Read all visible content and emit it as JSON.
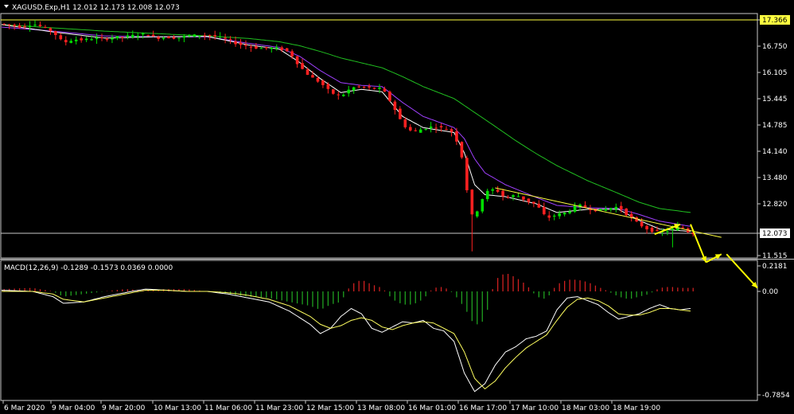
{
  "window": {
    "symbol_line": "XAGUSD.Exp,H1  12.012 12.173 12.008 12.073",
    "macd_line": "MACD(12,26,9) -0.1289 -0.1573 0.0369 0.0000"
  },
  "colors": {
    "background": "#000000",
    "bull_candle": "#00e000",
    "bear_candle": "#ff2020",
    "ema_fast": "#ffffff",
    "ema_mid": "#a040ff",
    "ema_slow": "#20c020",
    "trendline": "#ffff40",
    "arrows": "#ffff00",
    "macd_hist_pos": "#d02020",
    "macd_hist_neg": "#20a020",
    "macd_main": "#ffffff",
    "macd_signal": "#ffff60",
    "grid_lines": "#c8c8c8"
  },
  "chart_data": [
    {
      "type": "candlestick",
      "symbol": "XAGUSD.Exp",
      "timeframe": "H1",
      "ohlc_last": {
        "open": 12.012,
        "high": 12.173,
        "low": 12.008,
        "close": 12.073
      },
      "y_ticks": [
        "17.366",
        "16.750",
        "16.105",
        "15.445",
        "14.785",
        "14.140",
        "13.480",
        "12.820",
        "12.073",
        "11.515"
      ],
      "ylim": [
        11.42,
        17.54
      ],
      "horizontal_levels": [
        17.366,
        12.073
      ],
      "x_ticks": [
        "6 Mar 2020",
        "9 Mar 04:00",
        "9 Mar 20:00",
        "10 Mar 13:00",
        "11 Mar 06:00",
        "11 Mar 23:00",
        "12 Mar 15:00",
        "13 Mar 08:00",
        "16 Mar 01:00",
        "16 Mar 17:00",
        "17 Mar 10:00",
        "18 Mar 03:00",
        "18 Mar 19:00"
      ],
      "price_path": [
        [
          0,
          17.3
        ],
        [
          4,
          17.22
        ],
        [
          6,
          17.3
        ],
        [
          8,
          17.22
        ],
        [
          10,
          17.1
        ],
        [
          12,
          16.83
        ],
        [
          14,
          16.92
        ],
        [
          16,
          16.9
        ],
        [
          18,
          16.95
        ],
        [
          20,
          16.92
        ],
        [
          22,
          16.97
        ],
        [
          24,
          16.98
        ],
        [
          26,
          17.02
        ],
        [
          28,
          17.05
        ],
        [
          30,
          16.95
        ],
        [
          32,
          16.97
        ],
        [
          34,
          16.95
        ],
        [
          36,
          17.0
        ],
        [
          38,
          17.02
        ],
        [
          40,
          17.02
        ],
        [
          42,
          16.98
        ],
        [
          44,
          16.9
        ],
        [
          46,
          16.8
        ],
        [
          48,
          16.75
        ],
        [
          50,
          16.7
        ],
        [
          52,
          16.7
        ],
        [
          54,
          16.7
        ],
        [
          56,
          16.6
        ],
        [
          58,
          16.25
        ],
        [
          60,
          16.0
        ],
        [
          62,
          15.85
        ],
        [
          64,
          15.6
        ],
        [
          66,
          15.5
        ],
        [
          68,
          15.72
        ],
        [
          70,
          15.75
        ],
        [
          72,
          15.7
        ],
        [
          74,
          15.7
        ],
        [
          76,
          15.3
        ],
        [
          78,
          14.8
        ],
        [
          80,
          14.6
        ],
        [
          82,
          14.7
        ],
        [
          84,
          14.75
        ],
        [
          86,
          14.7
        ],
        [
          88,
          14.6
        ],
        [
          90,
          13.8
        ],
        [
          91,
          12.55
        ],
        [
          92,
          12.5
        ],
        [
          94,
          13.1
        ],
        [
          96,
          13.2
        ],
        [
          98,
          12.95
        ],
        [
          100,
          13.05
        ],
        [
          102,
          12.9
        ],
        [
          104,
          12.8
        ],
        [
          106,
          12.45
        ],
        [
          108,
          12.55
        ],
        [
          110,
          12.6
        ],
        [
          112,
          12.8
        ],
        [
          114,
          12.7
        ],
        [
          116,
          12.65
        ],
        [
          118,
          12.7
        ],
        [
          120,
          12.75
        ],
        [
          122,
          12.5
        ],
        [
          124,
          12.3
        ],
        [
          126,
          12.15
        ],
        [
          128,
          12.1
        ],
        [
          130,
          12.15
        ],
        [
          132,
          12.25
        ],
        [
          134,
          12.07
        ]
      ],
      "ema_fast_path": [
        [
          0,
          17.28
        ],
        [
          10,
          17.1
        ],
        [
          20,
          16.95
        ],
        [
          30,
          16.98
        ],
        [
          40,
          16.99
        ],
        [
          48,
          16.78
        ],
        [
          54,
          16.68
        ],
        [
          58,
          16.35
        ],
        [
          62,
          15.95
        ],
        [
          66,
          15.6
        ],
        [
          70,
          15.68
        ],
        [
          74,
          15.62
        ],
        [
          78,
          15.0
        ],
        [
          82,
          14.72
        ],
        [
          88,
          14.6
        ],
        [
          90,
          14.1
        ],
        [
          92,
          13.3
        ],
        [
          94,
          13.05
        ],
        [
          98,
          13.0
        ],
        [
          104,
          12.82
        ],
        [
          108,
          12.6
        ],
        [
          114,
          12.68
        ],
        [
          120,
          12.68
        ],
        [
          124,
          12.4
        ],
        [
          128,
          12.18
        ],
        [
          134,
          12.12
        ]
      ],
      "ema_mid_path": [
        [
          0,
          17.22
        ],
        [
          10,
          17.12
        ],
        [
          20,
          17.0
        ],
        [
          30,
          16.98
        ],
        [
          40,
          16.98
        ],
        [
          48,
          16.82
        ],
        [
          54,
          16.72
        ],
        [
          58,
          16.5
        ],
        [
          62,
          16.15
        ],
        [
          66,
          15.85
        ],
        [
          70,
          15.78
        ],
        [
          74,
          15.75
        ],
        [
          78,
          15.35
        ],
        [
          82,
          15.0
        ],
        [
          88,
          14.72
        ],
        [
          90,
          14.45
        ],
        [
          92,
          13.95
        ],
        [
          94,
          13.6
        ],
        [
          98,
          13.3
        ],
        [
          104,
          12.98
        ],
        [
          108,
          12.78
        ],
        [
          114,
          12.72
        ],
        [
          120,
          12.7
        ],
        [
          124,
          12.55
        ],
        [
          128,
          12.38
        ],
        [
          134,
          12.25
        ]
      ],
      "ema_slow_path": [
        [
          0,
          17.28
        ],
        [
          10,
          17.2
        ],
        [
          20,
          17.12
        ],
        [
          30,
          17.06
        ],
        [
          40,
          17.0
        ],
        [
          48,
          16.94
        ],
        [
          54,
          16.86
        ],
        [
          58,
          16.76
        ],
        [
          62,
          16.62
        ],
        [
          66,
          16.46
        ],
        [
          70,
          16.34
        ],
        [
          74,
          16.22
        ],
        [
          78,
          16.0
        ],
        [
          82,
          15.75
        ],
        [
          88,
          15.45
        ],
        [
          92,
          15.1
        ],
        [
          96,
          14.75
        ],
        [
          100,
          14.4
        ],
        [
          104,
          14.08
        ],
        [
          108,
          13.78
        ],
        [
          114,
          13.4
        ],
        [
          120,
          13.08
        ],
        [
          124,
          12.86
        ],
        [
          128,
          12.7
        ],
        [
          134,
          12.6
        ]
      ],
      "trendlines": [
        [
          [
            0,
            17.366
          ],
          [
            140,
            17.366
          ]
        ],
        [
          [
            96,
            13.22
          ],
          [
            140,
            12.05
          ]
        ]
      ],
      "forecast_arrows": [
        [
          [
            127,
            12.05
          ],
          [
            132,
            12.3
          ]
        ],
        [
          [
            134,
            12.3
          ],
          [
            137,
            11.35
          ]
        ],
        [
          [
            137,
            11.35
          ],
          [
            140,
            11.55
          ]
        ],
        [
          [
            141,
            11.55
          ],
          [
            147,
            10.72
          ]
        ]
      ]
    },
    {
      "type": "macd",
      "title": "MACD(12,26,9) -0.1289 -0.1573 0.0369 0.0000",
      "params": [
        12,
        26,
        9
      ],
      "values": {
        "main": -0.1289,
        "signal": -0.1573,
        "histogram": 0.0369,
        "extra": 0.0
      },
      "y_ticks": [
        "0.2181",
        "0.00",
        "-0.7854"
      ],
      "ylim": [
        -0.8,
        0.24
      ],
      "histogram_path": [
        [
          0,
          0.02
        ],
        [
          6,
          0.03
        ],
        [
          10,
          0.0
        ],
        [
          12,
          -0.04
        ],
        [
          16,
          -0.02
        ],
        [
          20,
          0.0
        ],
        [
          24,
          0.02
        ],
        [
          28,
          0.01
        ],
        [
          32,
          0.02
        ],
        [
          36,
          0.02
        ],
        [
          40,
          0.0
        ],
        [
          44,
          -0.02
        ],
        [
          48,
          -0.04
        ],
        [
          52,
          -0.05
        ],
        [
          56,
          -0.08
        ],
        [
          60,
          -0.11
        ],
        [
          62,
          -0.14
        ],
        [
          64,
          -0.1
        ],
        [
          66,
          -0.08
        ],
        [
          68,
          0.06
        ],
        [
          70,
          0.1
        ],
        [
          72,
          0.06
        ],
        [
          74,
          0.03
        ],
        [
          76,
          -0.06
        ],
        [
          78,
          -0.1
        ],
        [
          80,
          -0.1
        ],
        [
          82,
          -0.06
        ],
        [
          84,
          0.03
        ],
        [
          86,
          0.04
        ],
        [
          88,
          -0.02
        ],
        [
          90,
          -0.12
        ],
        [
          92,
          -0.26
        ],
        [
          94,
          -0.22
        ],
        [
          96,
          0.1
        ],
        [
          98,
          0.16
        ],
        [
          100,
          0.12
        ],
        [
          102,
          0.06
        ],
        [
          104,
          -0.04
        ],
        [
          106,
          -0.06
        ],
        [
          108,
          0.06
        ],
        [
          110,
          0.1
        ],
        [
          112,
          0.1
        ],
        [
          114,
          0.08
        ],
        [
          116,
          0.04
        ],
        [
          118,
          0.0
        ],
        [
          120,
          -0.04
        ],
        [
          122,
          -0.06
        ],
        [
          124,
          -0.04
        ],
        [
          126,
          -0.02
        ],
        [
          128,
          0.03
        ],
        [
          130,
          0.04
        ],
        [
          132,
          0.03
        ],
        [
          134,
          0.03
        ]
      ],
      "main_path": [
        [
          0,
          0.01
        ],
        [
          6,
          0.0
        ],
        [
          10,
          -0.04
        ],
        [
          12,
          -0.09
        ],
        [
          16,
          -0.08
        ],
        [
          20,
          -0.04
        ],
        [
          24,
          -0.01
        ],
        [
          28,
          0.02
        ],
        [
          32,
          0.01
        ],
        [
          36,
          0.0
        ],
        [
          40,
          0.0
        ],
        [
          44,
          -0.02
        ],
        [
          48,
          -0.05
        ],
        [
          52,
          -0.08
        ],
        [
          56,
          -0.15
        ],
        [
          60,
          -0.25
        ],
        [
          62,
          -0.32
        ],
        [
          64,
          -0.28
        ],
        [
          66,
          -0.19
        ],
        [
          68,
          -0.13
        ],
        [
          70,
          -0.17
        ],
        [
          72,
          -0.28
        ],
        [
          74,
          -0.31
        ],
        [
          76,
          -0.27
        ],
        [
          78,
          -0.23
        ],
        [
          80,
          -0.24
        ],
        [
          82,
          -0.22
        ],
        [
          84,
          -0.28
        ],
        [
          86,
          -0.3
        ],
        [
          88,
          -0.38
        ],
        [
          90,
          -0.62
        ],
        [
          92,
          -0.76
        ],
        [
          94,
          -0.7
        ],
        [
          96,
          -0.56
        ],
        [
          98,
          -0.46
        ],
        [
          100,
          -0.42
        ],
        [
          102,
          -0.36
        ],
        [
          104,
          -0.34
        ],
        [
          106,
          -0.3
        ],
        [
          108,
          -0.14
        ],
        [
          110,
          -0.05
        ],
        [
          112,
          -0.04
        ],
        [
          114,
          -0.07
        ],
        [
          116,
          -0.1
        ],
        [
          118,
          -0.16
        ],
        [
          120,
          -0.21
        ],
        [
          122,
          -0.19
        ],
        [
          124,
          -0.17
        ],
        [
          126,
          -0.13
        ],
        [
          128,
          -0.1
        ],
        [
          130,
          -0.13
        ],
        [
          132,
          -0.14
        ],
        [
          134,
          -0.13
        ]
      ],
      "signal_path": [
        [
          0,
          0.0
        ],
        [
          6,
          0.0
        ],
        [
          10,
          -0.02
        ],
        [
          12,
          -0.06
        ],
        [
          16,
          -0.08
        ],
        [
          20,
          -0.05
        ],
        [
          24,
          -0.02
        ],
        [
          28,
          0.01
        ],
        [
          32,
          0.01
        ],
        [
          36,
          0.0
        ],
        [
          40,
          0.0
        ],
        [
          44,
          -0.01
        ],
        [
          48,
          -0.03
        ],
        [
          52,
          -0.06
        ],
        [
          56,
          -0.11
        ],
        [
          60,
          -0.19
        ],
        [
          62,
          -0.25
        ],
        [
          64,
          -0.28
        ],
        [
          66,
          -0.26
        ],
        [
          68,
          -0.22
        ],
        [
          70,
          -0.2
        ],
        [
          72,
          -0.22
        ],
        [
          74,
          -0.27
        ],
        [
          76,
          -0.29
        ],
        [
          78,
          -0.26
        ],
        [
          80,
          -0.24
        ],
        [
          82,
          -0.23
        ],
        [
          84,
          -0.24
        ],
        [
          86,
          -0.28
        ],
        [
          88,
          -0.32
        ],
        [
          90,
          -0.46
        ],
        [
          92,
          -0.66
        ],
        [
          94,
          -0.74
        ],
        [
          96,
          -0.68
        ],
        [
          98,
          -0.58
        ],
        [
          100,
          -0.5
        ],
        [
          102,
          -0.43
        ],
        [
          104,
          -0.38
        ],
        [
          106,
          -0.33
        ],
        [
          108,
          -0.22
        ],
        [
          110,
          -0.12
        ],
        [
          112,
          -0.06
        ],
        [
          114,
          -0.05
        ],
        [
          116,
          -0.07
        ],
        [
          118,
          -0.11
        ],
        [
          120,
          -0.17
        ],
        [
          122,
          -0.18
        ],
        [
          124,
          -0.18
        ],
        [
          126,
          -0.16
        ],
        [
          128,
          -0.13
        ],
        [
          130,
          -0.13
        ],
        [
          132,
          -0.14
        ],
        [
          134,
          -0.15
        ]
      ]
    }
  ]
}
